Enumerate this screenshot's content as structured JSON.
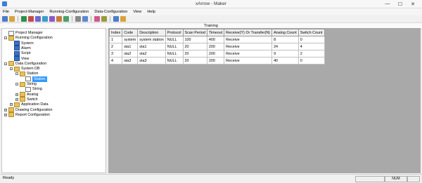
{
  "window": {
    "title": "xArrow - Maker",
    "minimize": "—",
    "maximize": "☐",
    "close": "✕"
  },
  "menu": [
    "File",
    "Project-Manager",
    "Running-Configuration",
    "Data-Configuration",
    "View",
    "Help"
  ],
  "toolbar_icons": [
    "new-icon",
    "open-icon",
    "sep",
    "display-icon",
    "alarm-icon",
    "script-icon",
    "view-icon",
    "data-icon",
    "xarrow-icon",
    "run-icon",
    "sep",
    "play-icon",
    "pause-icon",
    "sep",
    "grid-icon",
    "window-icon",
    "sep",
    "config-icon",
    "help-icon"
  ],
  "caption": "Training",
  "tree": [
    {
      "label": "Project Manager",
      "level": 0,
      "expander": "",
      "icon": "doc"
    },
    {
      "label": "Running Configuration",
      "level": 0,
      "expander": "-",
      "icon": "folder"
    },
    {
      "label": "System",
      "level": 1,
      "expander": "",
      "icon": "monitor"
    },
    {
      "label": "Alarm",
      "level": 1,
      "expander": "",
      "icon": "monitor"
    },
    {
      "label": "Script",
      "level": 1,
      "expander": "",
      "icon": "monitor"
    },
    {
      "label": "View",
      "level": 1,
      "expander": "",
      "icon": "monitor"
    },
    {
      "label": "Data Configuration",
      "level": 0,
      "expander": "-",
      "icon": "folder"
    },
    {
      "label": "System DB",
      "level": 1,
      "expander": "-",
      "icon": "folder"
    },
    {
      "label": "Station",
      "level": 2,
      "expander": "-",
      "icon": "folder"
    },
    {
      "label": "Station",
      "level": 3,
      "expander": "",
      "icon": "doc",
      "selected": true
    },
    {
      "label": "String",
      "level": 2,
      "expander": "-",
      "icon": "folder"
    },
    {
      "label": "String",
      "level": 3,
      "expander": "",
      "icon": "doc"
    },
    {
      "label": "Analog",
      "level": 2,
      "expander": "+",
      "icon": "folder"
    },
    {
      "label": "Switch",
      "level": 2,
      "expander": "+",
      "icon": "folder"
    },
    {
      "label": "Application Data",
      "level": 1,
      "expander": "+",
      "icon": "folder"
    },
    {
      "label": "Drawing Configuration",
      "level": 0,
      "expander": "+",
      "icon": "folder"
    },
    {
      "label": "Report Configuration",
      "level": 0,
      "expander": "+",
      "icon": "folder"
    }
  ],
  "table": {
    "columns": [
      "Index",
      "Code",
      "Description",
      "Protocol",
      "Scan Period",
      "Timeout",
      "Receive(Y) Or Transfer(N)",
      "Analog Count",
      "Switch Count"
    ],
    "rows": [
      [
        "1",
        "system",
        "system station",
        "NULL",
        "100",
        "400",
        "Receive",
        "8",
        "0"
      ],
      [
        "2",
        "sta1",
        "sta1",
        "NULL",
        "20",
        "200",
        "Receive",
        "24",
        "4"
      ],
      [
        "3",
        "sta2",
        "sta2",
        "NULL",
        "20",
        "200",
        "Receive",
        "9",
        "2"
      ],
      [
        "4",
        "sta3",
        "sta3",
        "NULL",
        "20",
        "200",
        "Receive",
        "40",
        "0"
      ]
    ]
  },
  "status": {
    "ready": "Ready",
    "num": "NUM"
  },
  "colors": {
    "selection": "#3399ff",
    "grid_bg": "#a9a9a9",
    "folder": "#e8c25a",
    "monitor": "#3a70c8"
  }
}
